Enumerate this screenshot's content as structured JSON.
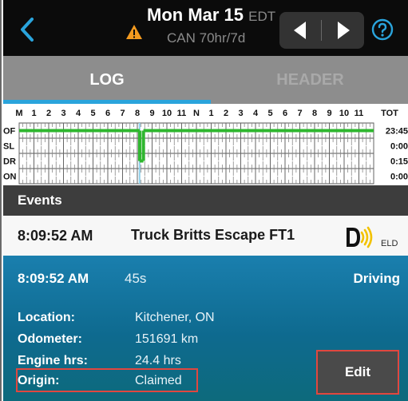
{
  "header": {
    "date": "Mon Mar 15",
    "timezone": "EDT",
    "cycle": "CAN 70hr/7d"
  },
  "tabs": [
    {
      "label": "LOG",
      "active": true
    },
    {
      "label": "HEADER",
      "active": false
    }
  ],
  "grid": {
    "hour_labels": [
      "M",
      "1",
      "2",
      "3",
      "4",
      "5",
      "6",
      "7",
      "8",
      "9",
      "10",
      "11",
      "N",
      "1",
      "2",
      "3",
      "4",
      "5",
      "6",
      "7",
      "8",
      "9",
      "10",
      "11"
    ],
    "total_header": "TOT",
    "rows": [
      {
        "status": "OF",
        "total": "23:45"
      },
      {
        "status": "SL",
        "total": "0:00"
      },
      {
        "status": "DR",
        "total": "0:15"
      },
      {
        "status": "ON",
        "total": "0:00"
      }
    ],
    "line_color": "#2fb72f",
    "marker_color": "#8fd0ea"
  },
  "events": {
    "title": "Events",
    "list": [
      {
        "time": "8:09:52 AM",
        "description": "Truck Britts Escape FT1",
        "source": "ELD"
      }
    ],
    "selected": {
      "time": "8:09:52 AM",
      "duration": "45s",
      "status": "Driving",
      "details": [
        {
          "label": "Location:",
          "value": "Kitchener, ON"
        },
        {
          "label": "Odometer:",
          "value": "151691 km"
        },
        {
          "label": "Engine hrs:",
          "value": "24.4 hrs"
        },
        {
          "label": "Origin:",
          "value": "Claimed"
        }
      ],
      "edit_label": "Edit"
    }
  },
  "colors": {
    "accent": "#2aa4dc",
    "highlight_border": "#e0473f",
    "warning": "#f39a1f"
  }
}
